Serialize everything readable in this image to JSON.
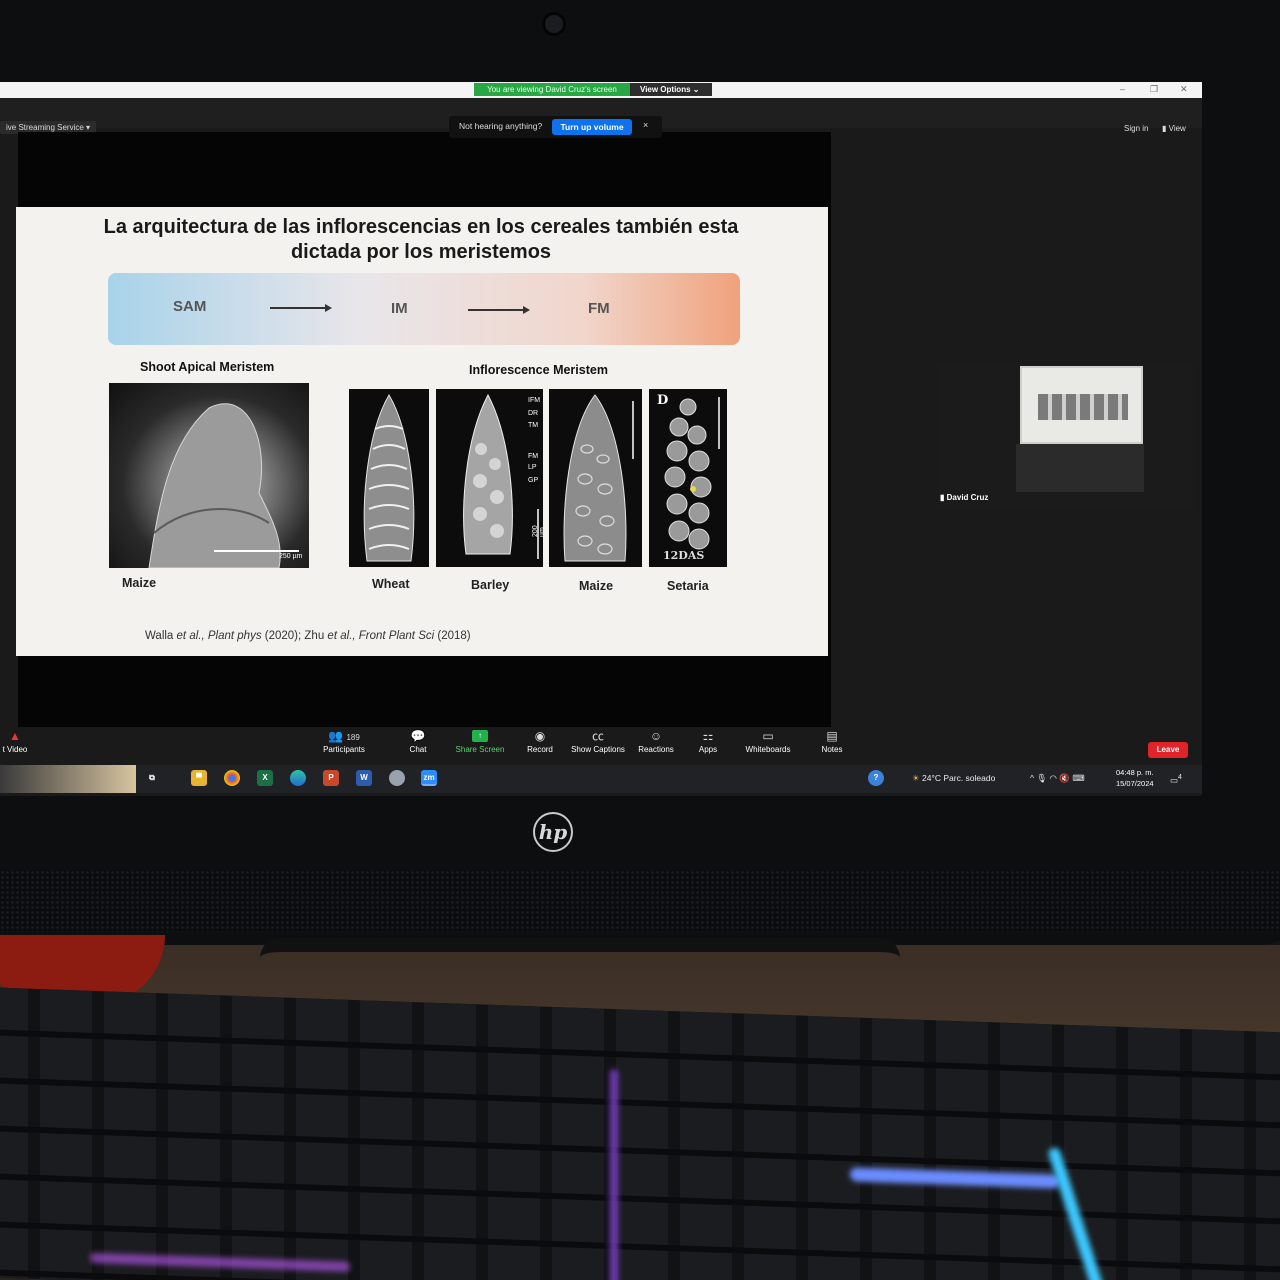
{
  "zoom": {
    "share_banner": "You are viewing David Cruz's screen",
    "view_options": "View Options",
    "live_streaming": "ive Streaming Service",
    "sign_in": "Sign in",
    "view": "View",
    "audio_notice": {
      "text": "Not hearing anything?",
      "button": "Turn up volume",
      "close": "×"
    },
    "participant_thumbnail": {
      "name": "David Cruz"
    },
    "toolbar": {
      "video": "t Video",
      "participants": "Participants",
      "participants_count": "189",
      "chat": "Chat",
      "share_screen": "Share Screen",
      "record": "Record",
      "show_captions": "Show Captions",
      "reactions": "Reactions",
      "apps": "Apps",
      "whiteboards": "Whiteboards",
      "notes": "Notes",
      "leave": "Leave"
    }
  },
  "slide": {
    "title_line1": "La arquitectura de las inflorescencias en los cereales también esta",
    "title_line2": "dictada por los meristemos",
    "stages": [
      "SAM",
      "IM",
      "FM"
    ],
    "shoot_apical_label": "Shoot Apical Meristem",
    "inflorescence_label": "Inflorescence Meristem",
    "panels": [
      "Maize",
      "Wheat",
      "Barley",
      "Maize",
      "Setaria"
    ],
    "barley_annotations": [
      "IFM",
      "DR",
      "TM",
      "FM",
      "LP",
      "GP"
    ],
    "scale_250": "250 µm",
    "scale_200": "200 µm",
    "setaria_panel_letter": "D",
    "setaria_das": "12DAS",
    "citation": {
      "a1": "Walla ",
      "a1_etal": "et al",
      "a1_journal": "., Plant phys",
      "a1_year": " (2020); Zhu ",
      "a2_etal": "et al",
      "a2_journal": "., Front Plant Sci",
      "a2_year": " (2018)"
    }
  },
  "taskbar": {
    "weather": "24°C  Parc. soleado",
    "time": "04:48 p. m.",
    "date": "15/07/2024",
    "notification_count": "4"
  },
  "monitor_brand": "hp"
}
